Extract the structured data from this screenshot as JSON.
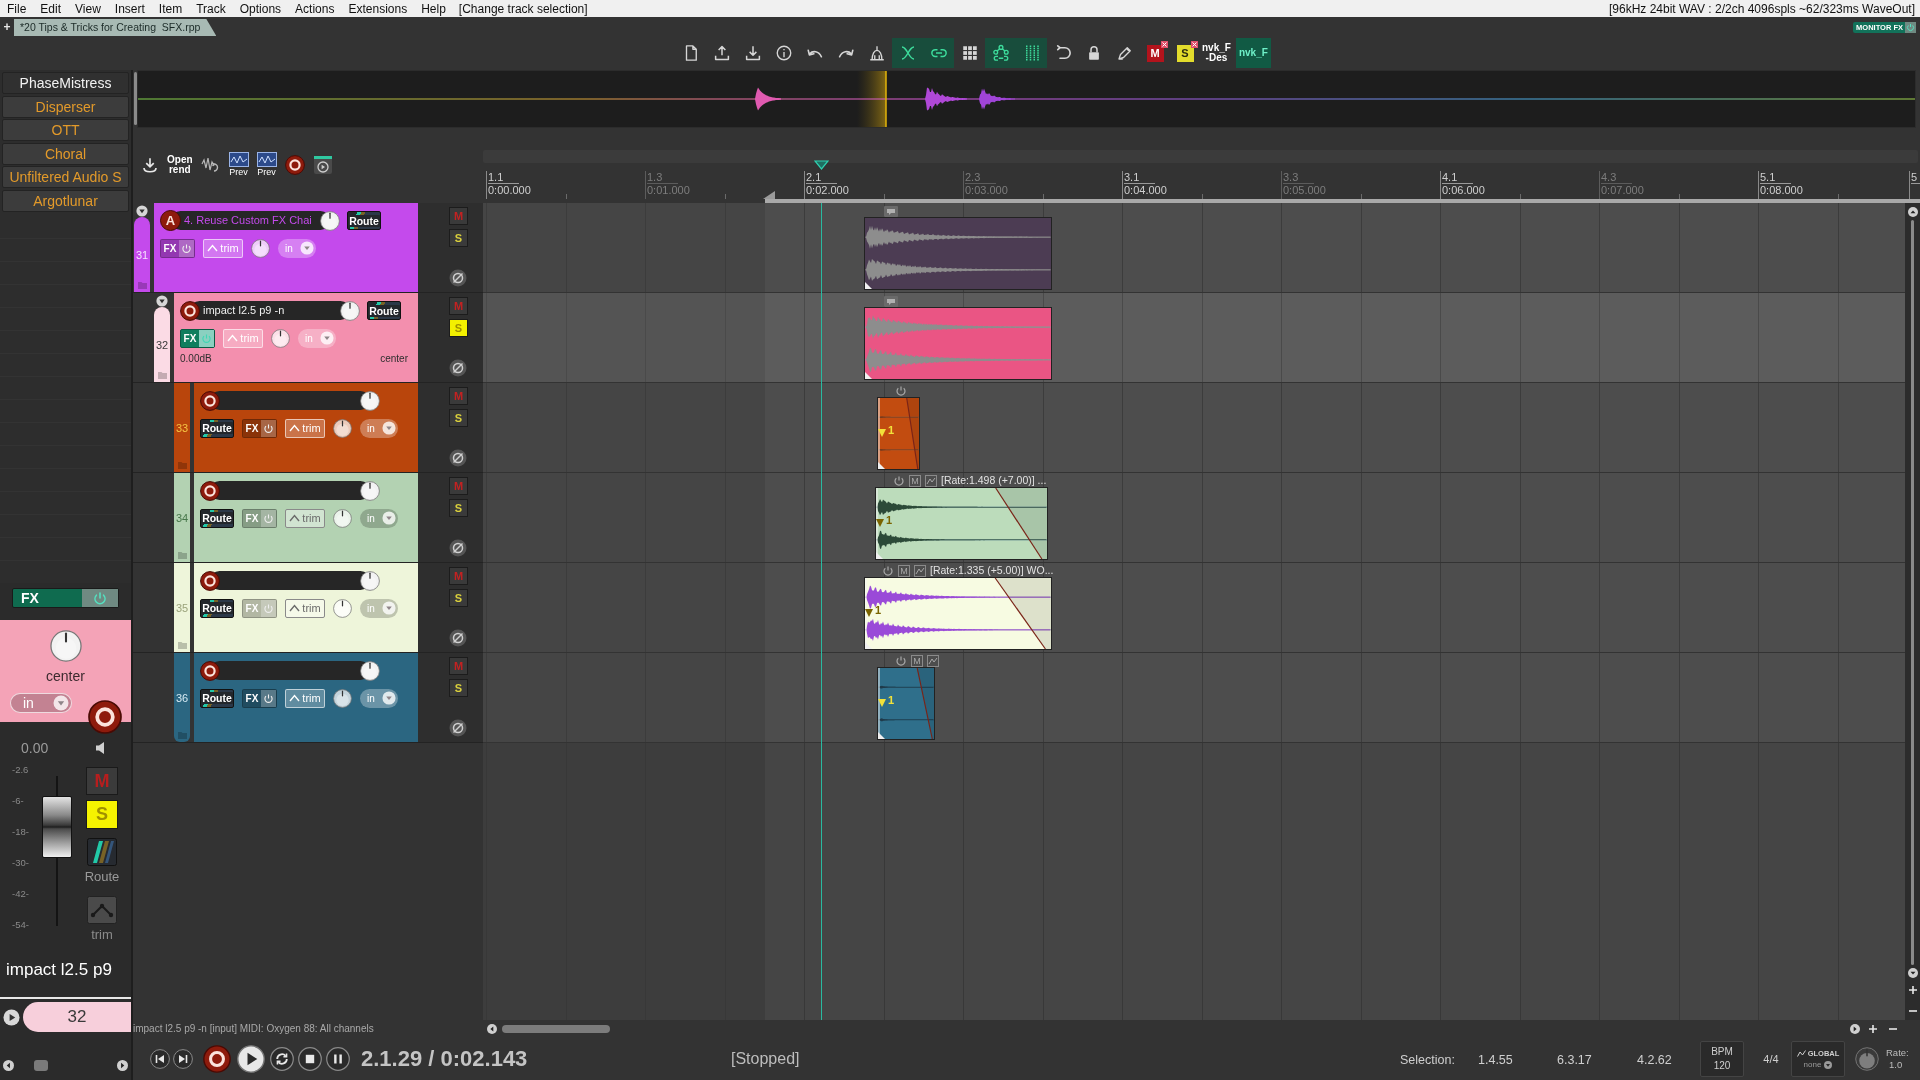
{
  "menu_bar": {
    "items": [
      "File",
      "Edit",
      "View",
      "Insert",
      "Item",
      "Track",
      "Options",
      "Actions",
      "Extensions",
      "Help"
    ],
    "action_hint": "[Change track selection]",
    "audio_status": "[96kHz 24bit WAV : 2/2ch 4096spls ~62/323ms WaveOut]"
  },
  "project_tabs": {
    "new_tab": "+",
    "tabs": [
      {
        "label": "*20 Tips & Tricks for Creating  SFX.rpp",
        "selected": true
      }
    ]
  },
  "monitor_fx": {
    "label": "MONITOR FX"
  },
  "main_toolbar": {
    "icon_buttons": [
      {
        "on": false
      },
      {
        "on": false
      },
      {
        "on": false
      },
      {
        "on": false
      },
      {
        "on": false
      },
      {
        "on": false
      },
      {
        "on": false
      },
      {
        "on": true
      },
      {
        "on": true
      },
      {
        "on": false
      },
      {
        "on": true
      },
      {
        "on": true
      },
      {
        "on": false
      },
      {
        "on": false
      },
      {
        "on": false
      }
    ],
    "script_buttons": [
      {
        "kind": "badge",
        "label": "M",
        "color": "#b3131c"
      },
      {
        "kind": "badge",
        "label": "S",
        "color": "#e3dc2c"
      },
      {
        "kind": "text",
        "lines": [
          "nvk_F",
          "-Des"
        ]
      },
      {
        "kind": "toggle",
        "label": "nvk_F",
        "on": true
      }
    ]
  },
  "fx_browser": [
    {
      "label": "PhaseMistress",
      "selected": true
    },
    {
      "label": "Disperser",
      "selected": false
    },
    {
      "label": "OTT",
      "selected": false
    },
    {
      "label": "Choral",
      "selected": false
    },
    {
      "label": "Unfiltered Audio S",
      "selected": false
    },
    {
      "label": "Argotlunar",
      "selected": false
    }
  ],
  "render_toolbar": {
    "open_render": [
      "Open",
      "rend"
    ],
    "preview_labels": [
      "Prev",
      "Prev"
    ]
  },
  "ruler": {
    "marks": [
      {
        "bar": "1.1",
        "time": "0:00.000",
        "major": true
      },
      {
        "bar": "1.3",
        "time": "0:01.000",
        "major": false
      },
      {
        "bar": "2.1",
        "time": "0:02.000",
        "major": true
      },
      {
        "bar": "2.3",
        "time": "0:03.000",
        "major": false
      },
      {
        "bar": "3.1",
        "time": "0:04.000",
        "major": true
      },
      {
        "bar": "3.3",
        "time": "0:05.000",
        "major": false
      },
      {
        "bar": "4.1",
        "time": "0:06.000",
        "major": true
      },
      {
        "bar": "4.3",
        "time": "0:07.000",
        "major": false
      },
      {
        "bar": "5.1",
        "time": "0:08.000",
        "major": true
      },
      {
        "bar": "5",
        "major": true
      }
    ]
  },
  "tracks": [
    {
      "number": "31",
      "name": "4. Reuse Custom FX Chai",
      "color": "#c44aec",
      "selected": false,
      "arm_label": "A",
      "fx_on": false,
      "solo": false,
      "buttons": {
        "route": "Route",
        "fx": "FX",
        "trim": "trim",
        "input": "in",
        "mute": "M",
        "solo": "S"
      },
      "item": {
        "kind": "note",
        "color": "#4c3c53"
      },
      "children": [
        {
          "number": "32",
          "name": "impact l2.5 p9 -n",
          "color": "#f38fae",
          "selected": true,
          "fx_on": true,
          "solo": true,
          "volume": "0.00dB",
          "pan": "center",
          "buttons": {
            "route": "Route",
            "fx": "FX",
            "trim": "trim",
            "input": "in",
            "mute": "M",
            "solo": "S"
          },
          "item": {
            "kind": "note",
            "color": "#ea5584"
          },
          "children": [
            {
              "number": "33",
              "color": "#b9450c",
              "selected": false,
              "fx_on": false,
              "solo": false,
              "buttons": {
                "route": "Route",
                "fx": "FX",
                "trim": "trim",
                "input": "in",
                "mute": "M",
                "solo": "S"
              },
              "item": {
                "kind": "take",
                "color": "#c24c10",
                "marker": "1"
              }
            },
            {
              "number": "34",
              "color": "#b3d2b2",
              "selected": false,
              "fx_on": false,
              "solo": false,
              "buttons": {
                "route": "Route",
                "fx": "FX",
                "trim": "trim",
                "input": "in",
                "mute": "M",
                "solo": "S"
              },
              "item": {
                "kind": "take",
                "color": "#bcdcbb",
                "marker": "1",
                "mute_label": "M",
                "label": "[Rate:1.498 (+7.00)] ..."
              }
            },
            {
              "number": "35",
              "color": "#eef5da",
              "selected": false,
              "fx_on": false,
              "solo": false,
              "buttons": {
                "route": "Route",
                "fx": "FX",
                "trim": "trim",
                "input": "in",
                "mute": "M",
                "solo": "S"
              },
              "item": {
                "kind": "take",
                "color": "#f7fbe2",
                "marker": "1",
                "mute_label": "M",
                "label": "[Rate:1.335 (+5.00)] WO..."
              }
            },
            {
              "number": "36",
              "color": "#2b6681",
              "selected": false,
              "fx_on": false,
              "solo": false,
              "buttons": {
                "route": "Route",
                "fx": "FX",
                "trim": "trim",
                "input": "in",
                "mute": "M",
                "solo": "S"
              },
              "item": {
                "kind": "take",
                "color": "#2f6f8b",
                "marker": "1",
                "mute_label": "M"
              }
            }
          ]
        }
      ]
    }
  ],
  "mixer_strip": {
    "fx_label": "FX",
    "fx_on": true,
    "pan": "center",
    "input": "in",
    "volume": "0.00",
    "scale": [
      "-2.6",
      "-6-",
      "-18-",
      "-30-",
      "-42-",
      "-54-"
    ],
    "level": 0.66,
    "mute": "M",
    "solo": "S",
    "solo_on": true,
    "route": "Route",
    "trim": "trim",
    "name": "impact l2.5 p9",
    "number": "32"
  },
  "status_line": "impact l2.5 p9 -n [input] MIDI: Oxygen 88: All channels",
  "transport": {
    "position": "2.1.29 / 0:02.143",
    "play_state": "[Stopped]",
    "selection_label": "Selection:",
    "selection": [
      "1.4.55",
      "6.3.17",
      "4.2.62"
    ],
    "bpm_label": "BPM",
    "bpm": "120",
    "time_signature": "4/4",
    "automation_label": "GLOBAL",
    "automation_mode": "none",
    "rate_label": "Rate:",
    "rate": "1.0"
  }
}
